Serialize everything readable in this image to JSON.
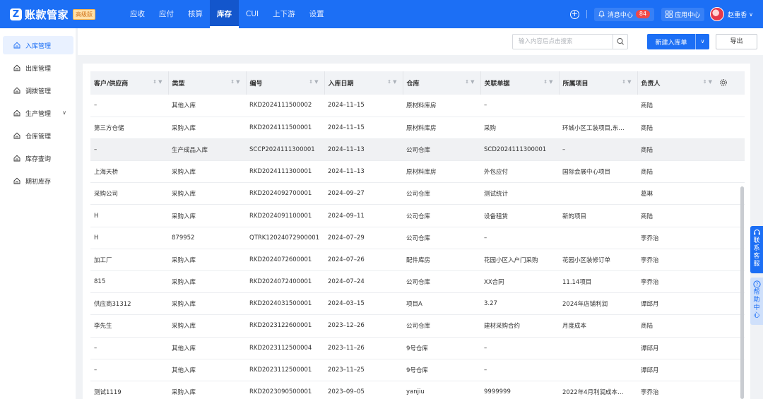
{
  "app": {
    "logo_mark": "Z",
    "name": "账款管家",
    "badge": "高级版"
  },
  "nav": [
    {
      "label": "应收"
    },
    {
      "label": "应付"
    },
    {
      "label": "核算"
    },
    {
      "label": "库存"
    },
    {
      "label": "CUI"
    },
    {
      "label": "上下游"
    },
    {
      "label": "设置"
    }
  ],
  "nav_active": "库存",
  "topright": {
    "plus_icon": "plus-circle-icon",
    "message_center": "消息中心",
    "message_count": "84",
    "app_center": "应用中心",
    "username": "赵重香"
  },
  "sidebar": [
    {
      "label": "入库管理",
      "active": true
    },
    {
      "label": "出库管理"
    },
    {
      "label": "调拨管理"
    },
    {
      "label": "生产管理",
      "expandable": true
    },
    {
      "label": "仓库管理"
    },
    {
      "label": "库存查询"
    },
    {
      "label": "期初库存"
    }
  ],
  "toolbar": {
    "search_placeholder": "输入内容后点击搜索",
    "new_button": "新建入库单",
    "export_button": "导出"
  },
  "table": {
    "columns": [
      "客户/供应商",
      "类型",
      "编号",
      "入库日期",
      "仓库",
      "关联单据",
      "所属项目",
      "负责人"
    ],
    "rows": [
      [
        "–",
        "其他入库",
        "RKD2024111500002",
        "2024–11–15",
        "原材料库房",
        "–",
        "",
        "商陆"
      ],
      [
        "第三方仓储",
        "采购入库",
        "RKD2024111500001",
        "2024–11–15",
        "原材料库房",
        "采购",
        "环城小区工装项目,东…",
        "商陆"
      ],
      [
        "–",
        "生产成品入库",
        "SCCP2024111300001",
        "2024–11–13",
        "公司仓库",
        "SCD2024111300001",
        "–",
        "商陆"
      ],
      [
        "上海天桥",
        "采购入库",
        "RKD2024111300001",
        "2024–11–13",
        "原材料库房",
        "外包应付",
        "国际会展中心项目",
        "商陆"
      ],
      [
        "采购公司",
        "采购入库",
        "RKD2024092700001",
        "2024–09–27",
        "公司仓库",
        "测试统计",
        "",
        "葛琳"
      ],
      [
        "H",
        "采购入库",
        "RKD2024091100001",
        "2024–09–11",
        "公司仓库",
        "设备租赁",
        "新的项目",
        "商陆"
      ],
      [
        "H",
        "879952",
        "QTRK12024072900001",
        "2024–07–29",
        "公司仓库",
        "–",
        "",
        "李乔治"
      ],
      [
        "加工厂",
        "采购入库",
        "RKD2024072600001",
        "2024–07–26",
        "配件库房",
        "花园小区入户门采购",
        "花园小区装修订单",
        "李乔治"
      ],
      [
        "815",
        "采购入库",
        "RKD2024072400001",
        "2024–07–24",
        "公司仓库",
        "XX合同",
        "11.14项目",
        "李乔治"
      ],
      [
        "供应商31312",
        "采购入库",
        "RKD2024031500001",
        "2024–03–15",
        "项目A",
        "3.27",
        "2024年店铺利润",
        "谭邱月"
      ],
      [
        "李先生",
        "采购入库",
        "RKD2023122600001",
        "2023–12–26",
        "公司仓库",
        "建材采购合约",
        "月度成本",
        "商陆"
      ],
      [
        "–",
        "其他入库",
        "RKD2023112500004",
        "2023–11–26",
        "9号仓库",
        "–",
        "",
        "谭邱月"
      ],
      [
        "–",
        "其他入库",
        "RKD2023112500001",
        "2023–11–25",
        "9号仓库",
        "–",
        "",
        "谭邱月"
      ],
      [
        "测试1119",
        "采购入库",
        "RKD2023090500001",
        "2023–09–05",
        "yanjiu",
        "9999999",
        "2022年4月利润成本…",
        "李乔治"
      ]
    ],
    "highlighted_row": 2
  },
  "float": {
    "contact": "联系客服",
    "help": "帮助中心"
  },
  "colors": {
    "primary": "#1c6ff5",
    "badge_bg": "#ffe0a8",
    "msg_count_bg": "#f04848"
  }
}
